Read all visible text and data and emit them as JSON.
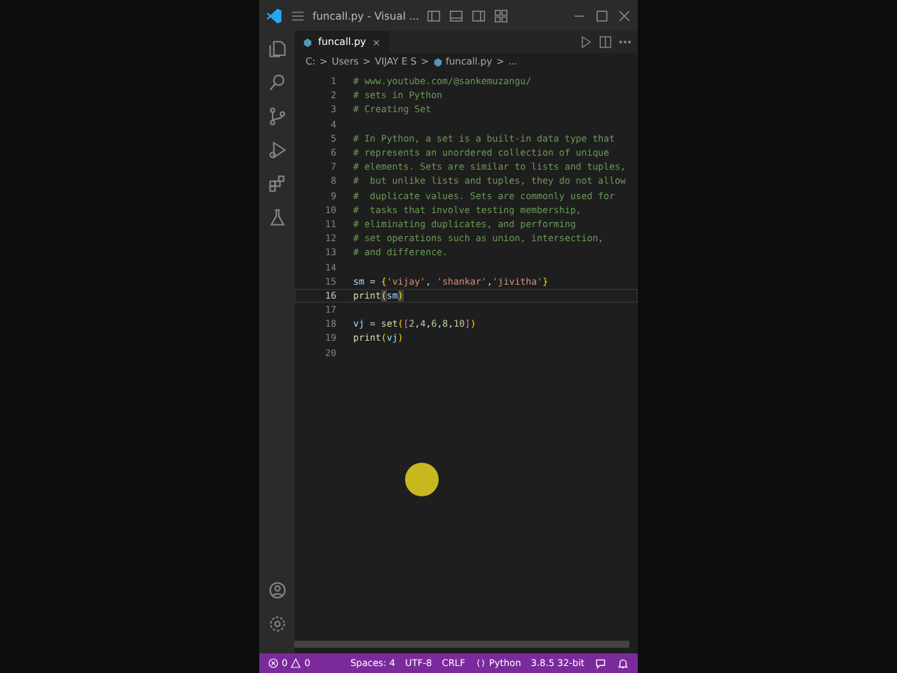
{
  "window": {
    "title": "funcall.py - Visual ..."
  },
  "tabs": [
    {
      "label": "funcall.py",
      "selected": true
    }
  ],
  "breadcrumb": [
    {
      "text": "C:",
      "kind": "text"
    },
    {
      "text": ">",
      "kind": "sep"
    },
    {
      "text": "Users",
      "kind": "text"
    },
    {
      "text": ">",
      "kind": "sep"
    },
    {
      "text": "VIJAY E S",
      "kind": "text"
    },
    {
      "text": ">",
      "kind": "sep"
    },
    {
      "text": "funcall.py",
      "kind": "file"
    },
    {
      "text": ">",
      "kind": "sep"
    },
    {
      "text": "...",
      "kind": "text"
    }
  ],
  "editor": {
    "lines": [
      {
        "number": "1",
        "current": false,
        "tokens": [
          {
            "text": "# www.youtube.com/@sankemuzangu/",
            "kind": "comment"
          }
        ]
      },
      {
        "number": "2",
        "current": false,
        "tokens": [
          {
            "text": "# sets in Python",
            "kind": "comment"
          }
        ]
      },
      {
        "number": "3",
        "current": false,
        "tokens": [
          {
            "text": "# Creating Set",
            "kind": "comment"
          }
        ]
      },
      {
        "number": "4",
        "current": false
      },
      {
        "number": "5",
        "current": false,
        "tokens": [
          {
            "text": "# In Python, a set is a built-in data type that",
            "kind": "comment"
          }
        ]
      },
      {
        "number": "6",
        "current": false,
        "tokens": [
          {
            "text": "# represents an unordered collection of unique",
            "kind": "comment"
          }
        ]
      },
      {
        "number": "7",
        "current": false,
        "tokens": [
          {
            "text": "# elements. Sets are similar to lists and tuples,",
            "kind": "comment"
          }
        ]
      },
      {
        "number": "8",
        "current": false,
        "tokens": [
          {
            "text": "#  but unlike lists and tuples, they do not allow",
            "kind": "comment"
          }
        ]
      },
      {
        "number": "9",
        "current": false,
        "tokens": [
          {
            "text": "#  duplicate values. Sets are commonly used for",
            "kind": "comment"
          }
        ]
      },
      {
        "number": "10",
        "current": false,
        "tokens": [
          {
            "text": "#  tasks that involve testing membership,",
            "kind": "comment"
          }
        ]
      },
      {
        "number": "11",
        "current": false,
        "tokens": [
          {
            "text": "# eliminating duplicates, and performing",
            "kind": "comment"
          }
        ]
      },
      {
        "number": "12",
        "current": false,
        "tokens": [
          {
            "text": "# set operations such as union, intersection,",
            "kind": "comment"
          }
        ]
      },
      {
        "number": "13",
        "current": false,
        "tokens": [
          {
            "text": "# and difference.",
            "kind": "comment"
          }
        ]
      },
      {
        "number": "14",
        "current": false
      },
      {
        "number": "15",
        "current": false,
        "tokens": [
          {
            "text": "sm",
            "kind": "variable"
          },
          {
            "text": " = ",
            "kind": "plain"
          },
          {
            "text": "{",
            "kind": "bracket"
          },
          {
            "text": "'vijay'",
            "kind": "string"
          },
          {
            "text": ", ",
            "kind": "plain"
          },
          {
            "text": "'shankar'",
            "kind": "string"
          },
          {
            "text": ",",
            "kind": "plain"
          },
          {
            "text": "'jivitha'",
            "kind": "string"
          },
          {
            "text": "}",
            "kind": "bracket"
          }
        ]
      },
      {
        "number": "16",
        "current": true,
        "tokens": [
          {
            "text": "print",
            "kind": "function"
          },
          {
            "text": "(",
            "kind": "matched"
          },
          {
            "text": "sm",
            "kind": "variable"
          },
          {
            "text": ")",
            "kind": "matched"
          }
        ]
      },
      {
        "number": "17",
        "current": false
      },
      {
        "number": "18",
        "current": false,
        "tokens": [
          {
            "text": "vj",
            "kind": "variable"
          },
          {
            "text": " = ",
            "kind": "plain"
          },
          {
            "text": "set",
            "kind": "function"
          },
          {
            "text": "(",
            "kind": "bracket"
          },
          {
            "text": "[",
            "kind": "bracket2"
          },
          {
            "text": "2",
            "kind": "number"
          },
          {
            "text": ",",
            "kind": "plain"
          },
          {
            "text": "4",
            "kind": "number"
          },
          {
            "text": ",",
            "kind": "plain"
          },
          {
            "text": "6",
            "kind": "number"
          },
          {
            "text": ",",
            "kind": "plain"
          },
          {
            "text": "8",
            "kind": "number"
          },
          {
            "text": ",",
            "kind": "plain"
          },
          {
            "text": "10",
            "kind": "number"
          },
          {
            "text": "]",
            "kind": "bracket2"
          },
          {
            "text": ")",
            "kind": "bracket"
          }
        ]
      },
      {
        "number": "19",
        "current": false,
        "tokens": [
          {
            "text": "print",
            "kind": "function"
          },
          {
            "text": "(",
            "kind": "bracket"
          },
          {
            "text": "vj",
            "kind": "variable"
          },
          {
            "text": ")",
            "kind": "bracket"
          }
        ]
      },
      {
        "number": "20",
        "current": false
      }
    ]
  },
  "status_bar": {
    "errors": "0",
    "warnings": "0",
    "items": [
      {
        "text": "Spaces: 4",
        "kind": "text"
      },
      {
        "text": "UTF-8",
        "kind": "text"
      },
      {
        "text": "CRLF",
        "kind": "text"
      },
      {
        "text": "Python",
        "kind": "language"
      },
      {
        "text": "3.8.5 32-bit",
        "kind": "text"
      }
    ]
  }
}
